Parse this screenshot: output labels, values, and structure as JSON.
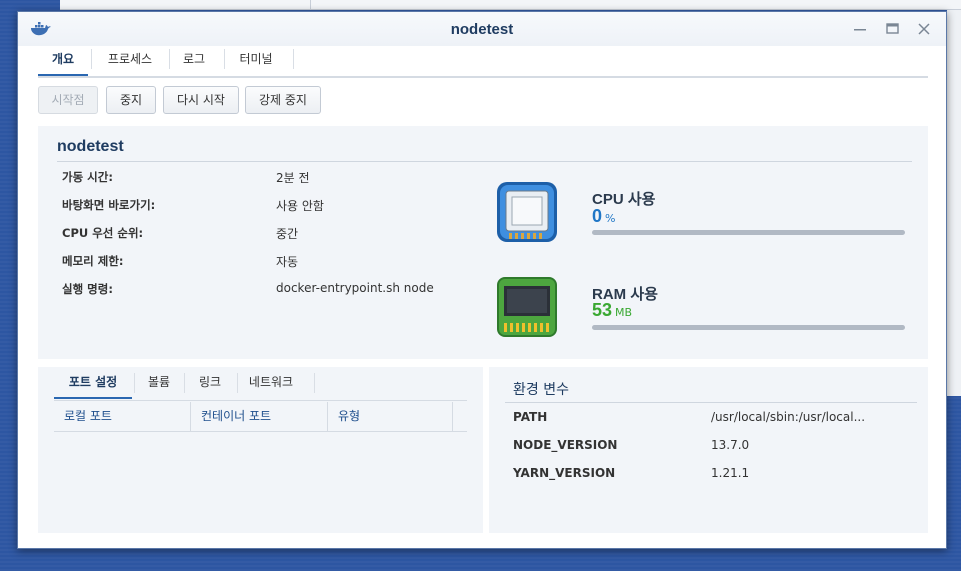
{
  "window": {
    "title": "nodetest"
  },
  "tabs": [
    {
      "label": "개요"
    },
    {
      "label": "프로세스"
    },
    {
      "label": "로그"
    },
    {
      "label": "터미널"
    }
  ],
  "toolbar": {
    "start_label": "시작점",
    "stop_label": "중지",
    "restart_label": "다시 시작",
    "force_stop_label": "강제 중지"
  },
  "overview": {
    "name": "nodetest",
    "rows": [
      {
        "label": "가동 시간:",
        "value": "2분 전"
      },
      {
        "label": "바탕화면 바로가기:",
        "value": "사용 안함"
      },
      {
        "label": "CPU 우선 순위:",
        "value": "중간"
      },
      {
        "label": "메모리 제한:",
        "value": "자동"
      },
      {
        "label": "실행 명령:",
        "value": "docker-entrypoint.sh node"
      }
    ],
    "cpu": {
      "label": "CPU 사용",
      "value": "0",
      "unit": "%",
      "usage_fraction": 0.0,
      "color": "#1f76c6"
    },
    "ram": {
      "label": "RAM 사용",
      "value": "53",
      "unit": "MB",
      "color": "#3aa832"
    }
  },
  "ports_panel": {
    "tabs": [
      {
        "label": "포트 설정"
      },
      {
        "label": "볼륨"
      },
      {
        "label": "링크"
      },
      {
        "label": "네트워크"
      }
    ],
    "columns": [
      "로컬 포트",
      "컨테이너 포트",
      "유형"
    ],
    "rows": []
  },
  "env_panel": {
    "title": "환경 변수",
    "vars": [
      {
        "key": "PATH",
        "value": "/usr/local/sbin:/usr/local..."
      },
      {
        "key": "NODE_VERSION",
        "value": "13.7.0"
      },
      {
        "key": "YARN_VERSION",
        "value": "1.21.1"
      }
    ]
  },
  "colors": {
    "accent": "#2a67b1",
    "title": "#1f3c61",
    "panel": "#f2f5f9"
  }
}
